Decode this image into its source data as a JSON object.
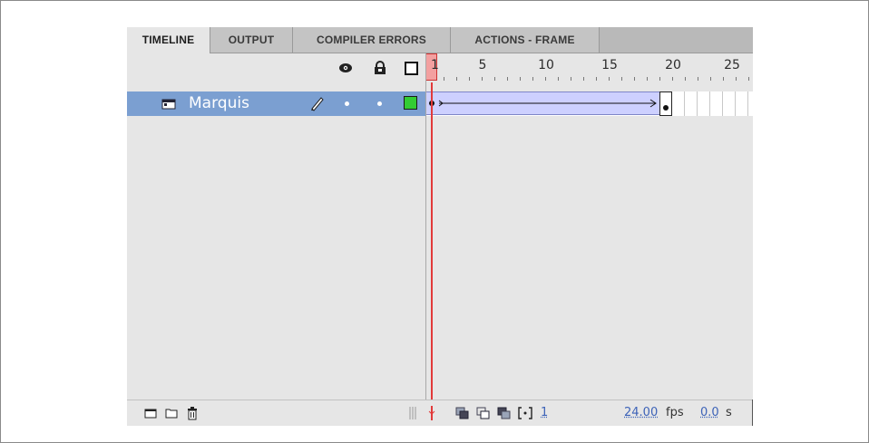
{
  "tabs": [
    {
      "label": "TIMELINE",
      "active": true
    },
    {
      "label": "OUTPUT",
      "active": false
    },
    {
      "label": "COMPILER ERRORS",
      "active": false
    },
    {
      "label": "ACTIONS - FRAME",
      "active": false
    }
  ],
  "header": {
    "icons": [
      "eye-icon",
      "lock-icon",
      "outline-square-icon"
    ],
    "playhead_frame": "1",
    "ruler_numbers": [
      "5",
      "10",
      "15",
      "20",
      "25"
    ]
  },
  "layer": {
    "name": "Marquis",
    "icons": [
      "layer-icon",
      "pencil-icon",
      "dot-icon",
      "dot-icon",
      "outline-color-icon"
    ],
    "outline_color": "#33cc33",
    "tween_start_frame": 1,
    "tween_end_frame": 20
  },
  "bottom_bar": {
    "icons": [
      "new-layer-icon",
      "new-folder-icon",
      "trash-icon",
      "center-frame-icon",
      "onion-skin-icon",
      "onion-skin-outline-icon",
      "edit-multiple-frames-icon",
      "modify-onion-markers-icon"
    ],
    "current_frame": "1",
    "fps_value": "24.00",
    "fps_unit": "fps",
    "time_value": "0.0",
    "time_unit": "s"
  },
  "colors": {
    "selected_layer": "#7b9fd1",
    "tween_fill": "#cdd0ff",
    "playhead": "#e23a3a"
  }
}
